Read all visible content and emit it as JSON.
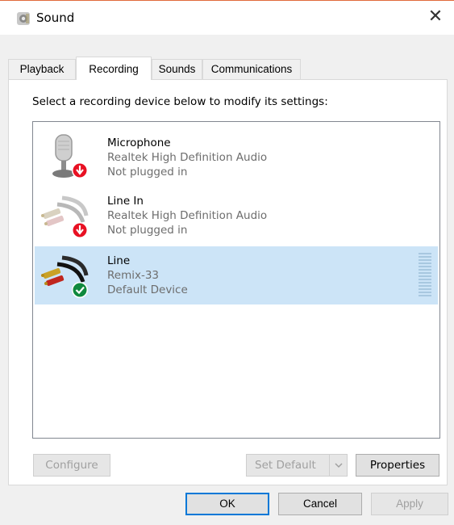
{
  "window": {
    "title": "Sound",
    "icon": "speaker-icon",
    "close_glyph": "✕"
  },
  "tabs": [
    {
      "label": "Playback",
      "active": false
    },
    {
      "label": "Recording",
      "active": true
    },
    {
      "label": "Sounds",
      "active": false
    },
    {
      "label": "Communications",
      "active": false
    }
  ],
  "recording": {
    "instruction": "Select a recording device below to modify its settings:",
    "devices": [
      {
        "name": "Microphone",
        "driver": "Realtek High Definition Audio",
        "status": "Not plugged in",
        "icon": "microphone-icon",
        "badge": "unplugged-icon",
        "selected": false
      },
      {
        "name": "Line In",
        "driver": "Realtek High Definition Audio",
        "status": "Not plugged in",
        "icon": "rca-cable-icon",
        "badge": "unplugged-icon",
        "selected": false
      },
      {
        "name": "Line",
        "driver": "Remix-33",
        "status": "Default Device",
        "icon": "rca-cable-icon",
        "badge": "default-check-icon",
        "selected": true
      }
    ]
  },
  "buttons": {
    "configure": "Configure",
    "set_default": "Set Default",
    "properties": "Properties",
    "ok": "OK",
    "cancel": "Cancel",
    "apply": "Apply"
  },
  "colors": {
    "selection": "#cce4f7",
    "accent": "#0078d7",
    "unplugged_badge": "#e81123",
    "default_badge": "#10893e"
  }
}
